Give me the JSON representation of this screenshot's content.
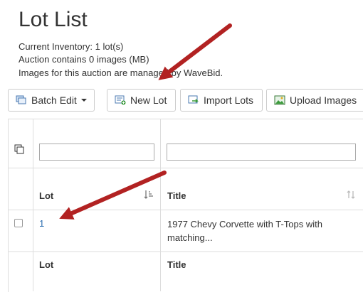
{
  "header": {
    "title": "Lot List",
    "current_inventory": "Current Inventory: 1 lot(s)",
    "images_count": "Auction contains 0 images (MB)",
    "images_managed": "Images for this auction are managed by WaveBid."
  },
  "toolbar": {
    "batch_edit_label": "Batch Edit",
    "new_lot_label": "New Lot",
    "import_lots_label": "Import Lots",
    "upload_images_label": "Upload Images"
  },
  "table": {
    "columns": [
      "Lot",
      "Title"
    ],
    "rows": [
      {
        "lot": "1",
        "title": "1977 Chevy Corvette with T-Tops with matching..."
      }
    ],
    "footer_columns": [
      "Lot",
      "Title"
    ]
  },
  "colors": {
    "annotation_arrow": "#b22222",
    "link": "#2a6db0",
    "border": "#dddddd"
  },
  "icons": [
    "columns-icon",
    "batch-edit-icon",
    "new-lot-icon",
    "import-lots-icon",
    "upload-images-icon",
    "sort-desc-icon",
    "sort-icon"
  ]
}
